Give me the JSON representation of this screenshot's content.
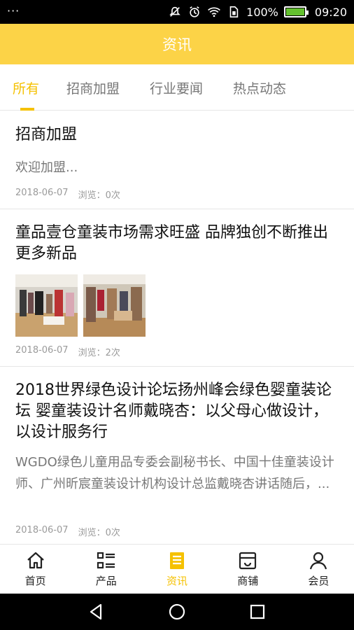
{
  "status_bar": {
    "dots": "···",
    "battery": "100%",
    "time": "09:20",
    "battery_level": 1.0
  },
  "app_bar": {
    "title": "资讯"
  },
  "tabs": [
    {
      "label": "所有",
      "active": true
    },
    {
      "label": "招商加盟",
      "active": false
    },
    {
      "label": "行业要闻",
      "active": false
    },
    {
      "label": "热点动态",
      "active": false
    }
  ],
  "articles": [
    {
      "title": "招商加盟",
      "summary": "欢迎加盟...",
      "date": "2018-06-07",
      "views": "浏览：0次"
    },
    {
      "title": "童品壹仓童装市场需求旺盛 品牌独创不断推出更多新品",
      "date": "2018-06-07",
      "views": "浏览：2次",
      "images": [
        "store-photo-1",
        "store-photo-2"
      ]
    },
    {
      "title": "2018世界绿色设计论坛扬州峰会绿色婴童装论坛 婴童装设计名师戴晓杏：以父母心做设计，以设计服务行",
      "summary": "WGDO绿色儿童用品专委会副秘书长、中国十佳童装设计师、广州昕宸童装设计机构设计总监戴晓杏讲话随后，...",
      "date": "2018-06-07",
      "views": "浏览：0次"
    }
  ],
  "bottom_nav": [
    {
      "label": "首页",
      "icon": "home-icon",
      "active": false
    },
    {
      "label": "产品",
      "icon": "list-icon",
      "active": false
    },
    {
      "label": "资讯",
      "icon": "news-icon",
      "active": true
    },
    {
      "label": "商铺",
      "icon": "store-icon",
      "active": false
    },
    {
      "label": "会员",
      "icon": "user-icon",
      "active": false
    }
  ],
  "colors": {
    "accent": "#f5c100",
    "app_bar": "#fcd347"
  }
}
